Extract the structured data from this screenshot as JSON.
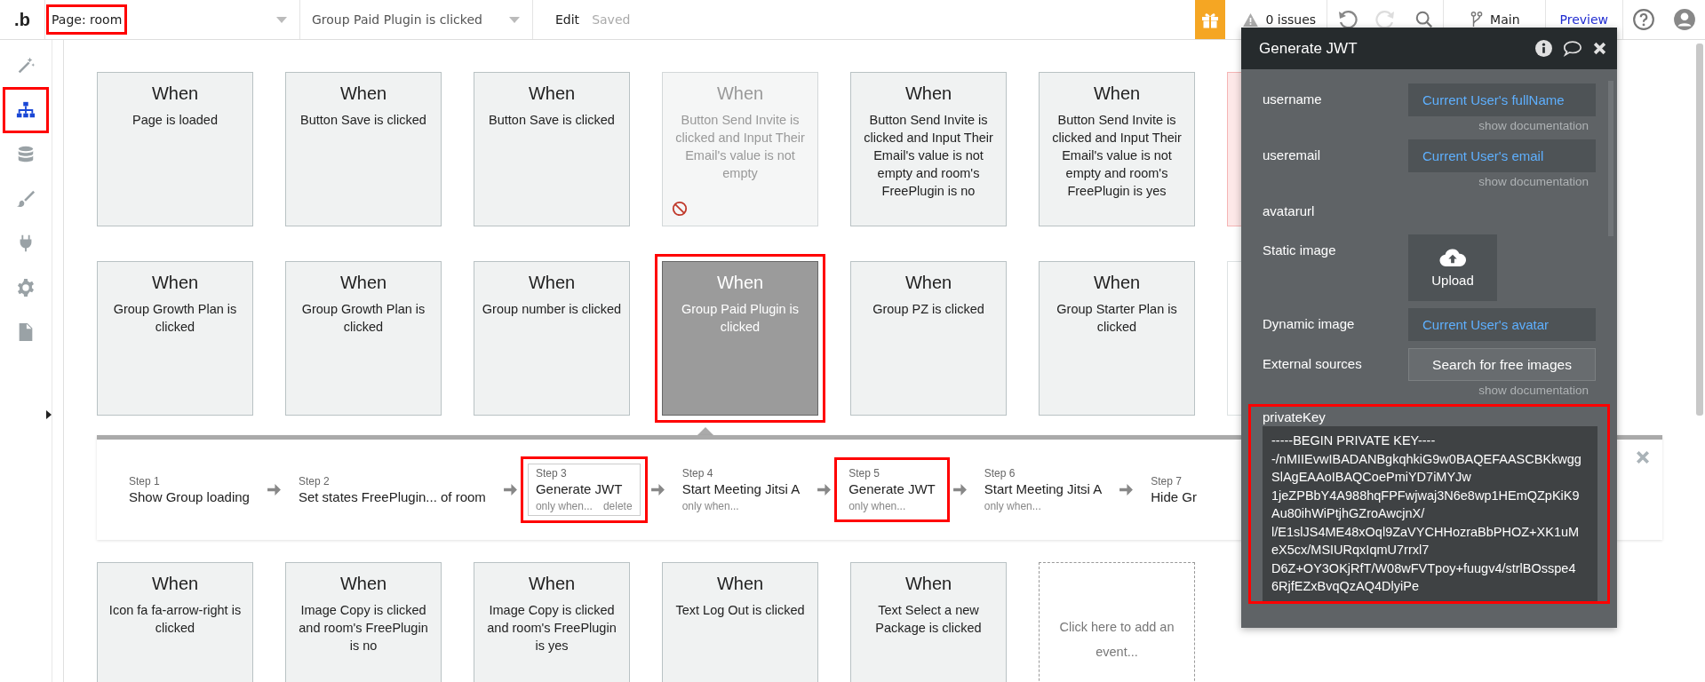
{
  "topbar": {
    "logo": ".b",
    "page_selector": {
      "label": "Page: room",
      "highlighted": true
    },
    "event_selector": {
      "label": "Group Paid Plugin is clicked"
    },
    "edit": "Edit",
    "save_status": "Saved",
    "issues": "0 issues",
    "branch": "Main",
    "preview": "Preview"
  },
  "sidebar": {
    "items": [
      {
        "kind": "design",
        "selected": false,
        "highlighted": false
      },
      {
        "kind": "workflow",
        "selected": true,
        "highlighted": true
      },
      {
        "kind": "data",
        "selected": false,
        "highlighted": false
      },
      {
        "kind": "styles",
        "selected": false,
        "highlighted": false
      },
      {
        "kind": "plugins",
        "selected": false,
        "highlighted": false
      },
      {
        "kind": "settings",
        "selected": false,
        "highlighted": false
      },
      {
        "kind": "logs",
        "selected": false,
        "highlighted": false
      }
    ]
  },
  "event_rows": [
    [
      {
        "kind": "event",
        "when": "When",
        "condition": "Page is loaded",
        "disabled": false,
        "selected": false,
        "highlighted": false
      },
      {
        "kind": "event",
        "when": "When",
        "condition": "Button Save is clicked",
        "disabled": false,
        "selected": false,
        "highlighted": false
      },
      {
        "kind": "event",
        "when": "When",
        "condition": "Button Save is clicked",
        "disabled": false,
        "selected": false,
        "highlighted": false
      },
      {
        "kind": "event",
        "when": "When",
        "condition": "Button Send Invite is clicked and Input Their Email's value is not empty",
        "disabled": true,
        "selected": false,
        "highlighted": false
      },
      {
        "kind": "event",
        "when": "When",
        "condition": "Button Send Invite is clicked and Input Their Email's value is not empty and room's FreePlugin is no",
        "disabled": false,
        "selected": false,
        "highlighted": false
      },
      {
        "kind": "event",
        "when": "When",
        "condition": "Button Send Invite is clicked and Input Their Email's value is not empty and room's FreePlugin is yes",
        "disabled": false,
        "selected": false,
        "highlighted": false
      },
      {
        "kind": "covered",
        "error": true
      }
    ],
    [
      {
        "kind": "event",
        "when": "When",
        "condition": "Group Growth Plan is clicked",
        "disabled": false,
        "selected": false,
        "highlighted": false
      },
      {
        "kind": "event",
        "when": "When",
        "condition": "Group Growth Plan is clicked",
        "disabled": false,
        "selected": false,
        "highlighted": false
      },
      {
        "kind": "event",
        "when": "When",
        "condition": "Group number is clicked",
        "disabled": false,
        "selected": false,
        "highlighted": false
      },
      {
        "kind": "event",
        "when": "When",
        "condition": "Group Paid Plugin is clicked",
        "disabled": false,
        "selected": true,
        "highlighted": true
      },
      {
        "kind": "event",
        "when": "When",
        "condition": "Group PZ is clicked",
        "disabled": false,
        "selected": false,
        "highlighted": false
      },
      {
        "kind": "event",
        "when": "When",
        "condition": "Group Starter Plan is clicked",
        "disabled": false,
        "selected": false,
        "highlighted": false
      },
      {
        "kind": "covered",
        "error": false
      }
    ]
  ],
  "steps": [
    {
      "label": "Step 1",
      "action": "Show Group loading",
      "selected": false,
      "highlighted": false
    },
    {
      "label": "Step 2",
      "action": "Set states FreePlugin... of room",
      "selected": false,
      "highlighted": false
    },
    {
      "label": "Step 3",
      "action": "Generate JWT",
      "condition": "only when...",
      "delete": "delete",
      "selected": true,
      "highlighted": true
    },
    {
      "label": "Step 4",
      "action": "Start Meeting Jitsi A",
      "condition": "only when...",
      "selected": false,
      "highlighted": false
    },
    {
      "label": "Step 5",
      "action": "Generate JWT",
      "condition": "only when...",
      "selected": false,
      "highlighted": true
    },
    {
      "label": "Step 6",
      "action": "Start Meeting Jitsi A",
      "condition": "only when...",
      "selected": false,
      "highlighted": false
    },
    {
      "label": "Step 7",
      "action": "Hide Gr",
      "selected": false,
      "highlighted": false
    }
  ],
  "bottom_row": [
    {
      "kind": "event",
      "when": "When",
      "condition": "Icon fa fa-arrow-right is clicked",
      "disabled": false,
      "selected": false,
      "highlighted": false
    },
    {
      "kind": "event",
      "when": "When",
      "condition": "Image Copy is clicked and room's FreePlugin is no",
      "disabled": false,
      "selected": false,
      "highlighted": false
    },
    {
      "kind": "event",
      "when": "When",
      "condition": "Image Copy is clicked and room's FreePlugin is yes",
      "disabled": false,
      "selected": false,
      "highlighted": false
    },
    {
      "kind": "event",
      "when": "When",
      "condition": "Text Log Out is clicked",
      "disabled": false,
      "selected": false,
      "highlighted": false
    },
    {
      "kind": "event",
      "when": "When",
      "condition": "Text Select a new Package is clicked",
      "disabled": false,
      "selected": false,
      "highlighted": false
    },
    {
      "kind": "add",
      "text": "Click here to add an event..."
    }
  ],
  "popup": {
    "title": "Generate JWT",
    "fields": [
      {
        "kind": "expression",
        "label": "username",
        "value": "Current User's fullName",
        "doc": "show documentation"
      },
      {
        "kind": "expression",
        "label": "useremail",
        "value": "Current User's email",
        "doc": "show documentation"
      },
      {
        "kind": "heading",
        "label": "avatarurl"
      },
      {
        "kind": "upload",
        "label": "Static image",
        "button": "Upload"
      },
      {
        "kind": "expression",
        "label": "Dynamic image",
        "value": "Current User's avatar"
      },
      {
        "kind": "button",
        "label": "External sources",
        "button": "Search for free images",
        "doc": "show documentation"
      },
      {
        "kind": "textarea",
        "label": "privateKey",
        "highlighted": true,
        "value": "-----BEGIN PRIVATE KEY----\n-/nMIIEvwIBADANBgkqhkiG9w0BAQEFAASCBKkwgg\nSlAgEAAoIBAQCoePmiYD7iMYJw\n1jeZPBbY4A988hqFPFwjwaj3N6e8wp1HEmQZpKiK9\nAu80ihWiPtjhGZroAwcjnX/\nl/E1slJS4ME48xOql9ZaVYCHHozraBbPHOZ+XK1uM\neX5cx/MSIURqxIqmU7rrxl7\nD6Z+OY3OKjRfT/W08wFVTpoy+fuugv4/strlBOsspe4\n6RjfEZxBvqQzAQ4DlyiPe"
      }
    ]
  }
}
